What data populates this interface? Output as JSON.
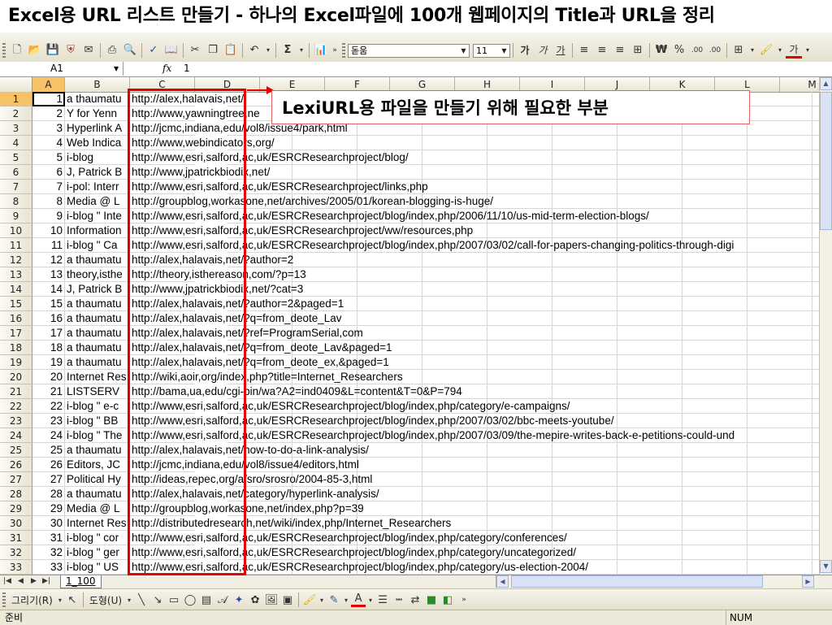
{
  "slide_title": "Excel용 URL 리스트 만들기 - 하나의 Excel파일에 100개 웹페이지의 Title과 URL을 정리",
  "callout_text": "LexiURL용 파일을 만들기 위해 필요한 부분",
  "toolbar": {
    "font_name": "돋움",
    "font_size": "11",
    "sum_label": "Σ",
    "bold_label": "가",
    "italic_label": "가",
    "underline_label": "가",
    "currency_label": "₩",
    "percent_label": "%",
    "inc_decimal_label": ".00",
    "dec_decimal_label": ".00",
    "font_color_label": "가"
  },
  "formula_bar": {
    "name_box": "A1",
    "fx": "fx",
    "value": "1"
  },
  "columns": [
    "A",
    "B",
    "C",
    "D",
    "E",
    "F",
    "G",
    "H",
    "I",
    "J",
    "K",
    "L",
    "M"
  ],
  "rows": [
    {
      "n": "1",
      "a": "1",
      "b": "a thaumatu",
      "url": "http://alex,halavais,net/"
    },
    {
      "n": "2",
      "a": "2",
      "b": "Y for Yenn",
      "url": "http://www,yawningtree,ne"
    },
    {
      "n": "3",
      "a": "3",
      "b": "Hyperlink A",
      "url": "http://jcmc,indiana,edu/vol8/issue4/park,html"
    },
    {
      "n": "4",
      "a": "4",
      "b": "Web Indica",
      "url": "http://www,webindicators,org/"
    },
    {
      "n": "5",
      "a": "5",
      "b": "i-blog",
      "url": "http://www,esri,salford,ac,uk/ESRCResearchproject/blog/"
    },
    {
      "n": "6",
      "a": "6",
      "b": "J, Patrick B",
      "url": "http://www,jpatrickbiodix,net/"
    },
    {
      "n": "7",
      "a": "7",
      "b": "i-pol: Interr",
      "url": "http://www,esri,salford,ac,uk/ESRCResearchproject/links,php"
    },
    {
      "n": "8",
      "a": "8",
      "b": "Media @ L",
      "url": "http://groupblog,workasone,net/archives/2005/01/korean-blogging-is-huge/"
    },
    {
      "n": "9",
      "a": "9",
      "b": "i-blog \" Inte",
      "url": "http://www,esri,salford,ac,uk/ESRCResearchproject/blog/index,php/2006/11/10/us-mid-term-election-blogs/"
    },
    {
      "n": "10",
      "a": "10",
      "b": "Information",
      "url": "http://www,esri,salford,ac,uk/ESRCResearchproject/ww/resources,php"
    },
    {
      "n": "11",
      "a": "11",
      "b": "i-blog \" Ca",
      "url": "http://www,esri,salford,ac,uk/ESRCResearchproject/blog/index,php/2007/03/02/call-for-papers-changing-politics-through-digi"
    },
    {
      "n": "12",
      "a": "12",
      "b": "a thaumatu",
      "url": "http://alex,halavais,net/?author=2"
    },
    {
      "n": "13",
      "a": "13",
      "b": "theory,isthe",
      "url": "http://theory,isthereason,com/?p=13"
    },
    {
      "n": "14",
      "a": "14",
      "b": "J, Patrick B",
      "url": "http://www,jpatrickbiodix,net/?cat=3"
    },
    {
      "n": "15",
      "a": "15",
      "b": "a thaumatu",
      "url": "http://alex,halavais,net/?author=2&paged=1"
    },
    {
      "n": "16",
      "a": "16",
      "b": "a thaumatu",
      "url": "http://alex,halavais,net/?q=from_deote_Lav"
    },
    {
      "n": "17",
      "a": "17",
      "b": "a thaumatu",
      "url": "http://alex,halavais,net/?ref=ProgramSerial,com"
    },
    {
      "n": "18",
      "a": "18",
      "b": "a thaumatu",
      "url": "http://alex,halavais,net/?q=from_deote_Lav&paged=1"
    },
    {
      "n": "19",
      "a": "19",
      "b": "a thaumatu",
      "url": "http://alex,halavais,net/?q=from_deote_ex,&paged=1"
    },
    {
      "n": "20",
      "a": "20",
      "b": "Internet Res",
      "url": "http://wiki,aoir,org/index,php?title=Internet_Researchers"
    },
    {
      "n": "21",
      "a": "21",
      "b": "LISTSERV",
      "url": "http://bama,ua,edu/cgi-bin/wa?A2=ind0409&L=content&T=0&P=794"
    },
    {
      "n": "22",
      "a": "22",
      "b": "i-blog \" e-c",
      "url": "http://www,esri,salford,ac,uk/ESRCResearchproject/blog/index,php/category/e-campaigns/"
    },
    {
      "n": "23",
      "a": "23",
      "b": "i-blog \" BB",
      "url": "http://www,esri,salford,ac,uk/ESRCResearchproject/blog/index,php/2007/03/02/bbc-meets-youtube/"
    },
    {
      "n": "24",
      "a": "24",
      "b": "i-blog \" The",
      "url": "http://www,esri,salford,ac,uk/ESRCResearchproject/blog/index,php/2007/03/09/the-mepire-writes-back-e-petitions-could-und"
    },
    {
      "n": "25",
      "a": "25",
      "b": "a thaumatu",
      "url": "http://alex,halavais,net/how-to-do-a-link-analysis/"
    },
    {
      "n": "26",
      "a": "26",
      "b": "Editors, JC",
      "url": "http://jcmc,indiana,edu/vol8/issue4/editors,html"
    },
    {
      "n": "27",
      "a": "27",
      "b": "Political Hy",
      "url": "http://ideas,repec,org/a/sro/srosro/2004-85-3,html"
    },
    {
      "n": "28",
      "a": "28",
      "b": "a thaumatu",
      "url": "http://alex,halavais,net/category/hyperlink-analysis/"
    },
    {
      "n": "29",
      "a": "29",
      "b": "Media @ L",
      "url": "http://groupblog,workasone,net/index,php?p=39"
    },
    {
      "n": "30",
      "a": "30",
      "b": "Internet Res",
      "url": "http://distributedresearch,net/wiki/index,php/Internet_Researchers"
    },
    {
      "n": "31",
      "a": "31",
      "b": "i-blog \" cor",
      "url": "http://www,esri,salford,ac,uk/ESRCResearchproject/blog/index,php/category/conferences/"
    },
    {
      "n": "32",
      "a": "32",
      "b": "i-blog \" ger",
      "url": "http://www,esri,salford,ac,uk/ESRCResearchproject/blog/index,php/category/uncategorized/"
    },
    {
      "n": "33",
      "a": "33",
      "b": "i-blog \" US",
      "url": "http://www,esri,salford,ac,uk/ESRCResearchproject/blog/index,php/category/us-election-2004/"
    }
  ],
  "sheet_tab": "1_100",
  "drawing_toolbar": {
    "draw_label": "그리기(R)",
    "shapes_label": "도형(U)"
  },
  "status_bar": {
    "ready": "준비",
    "num": "NUM"
  },
  "colors": {
    "highlight_red": "#e30000",
    "active_header": "#f7c266"
  }
}
